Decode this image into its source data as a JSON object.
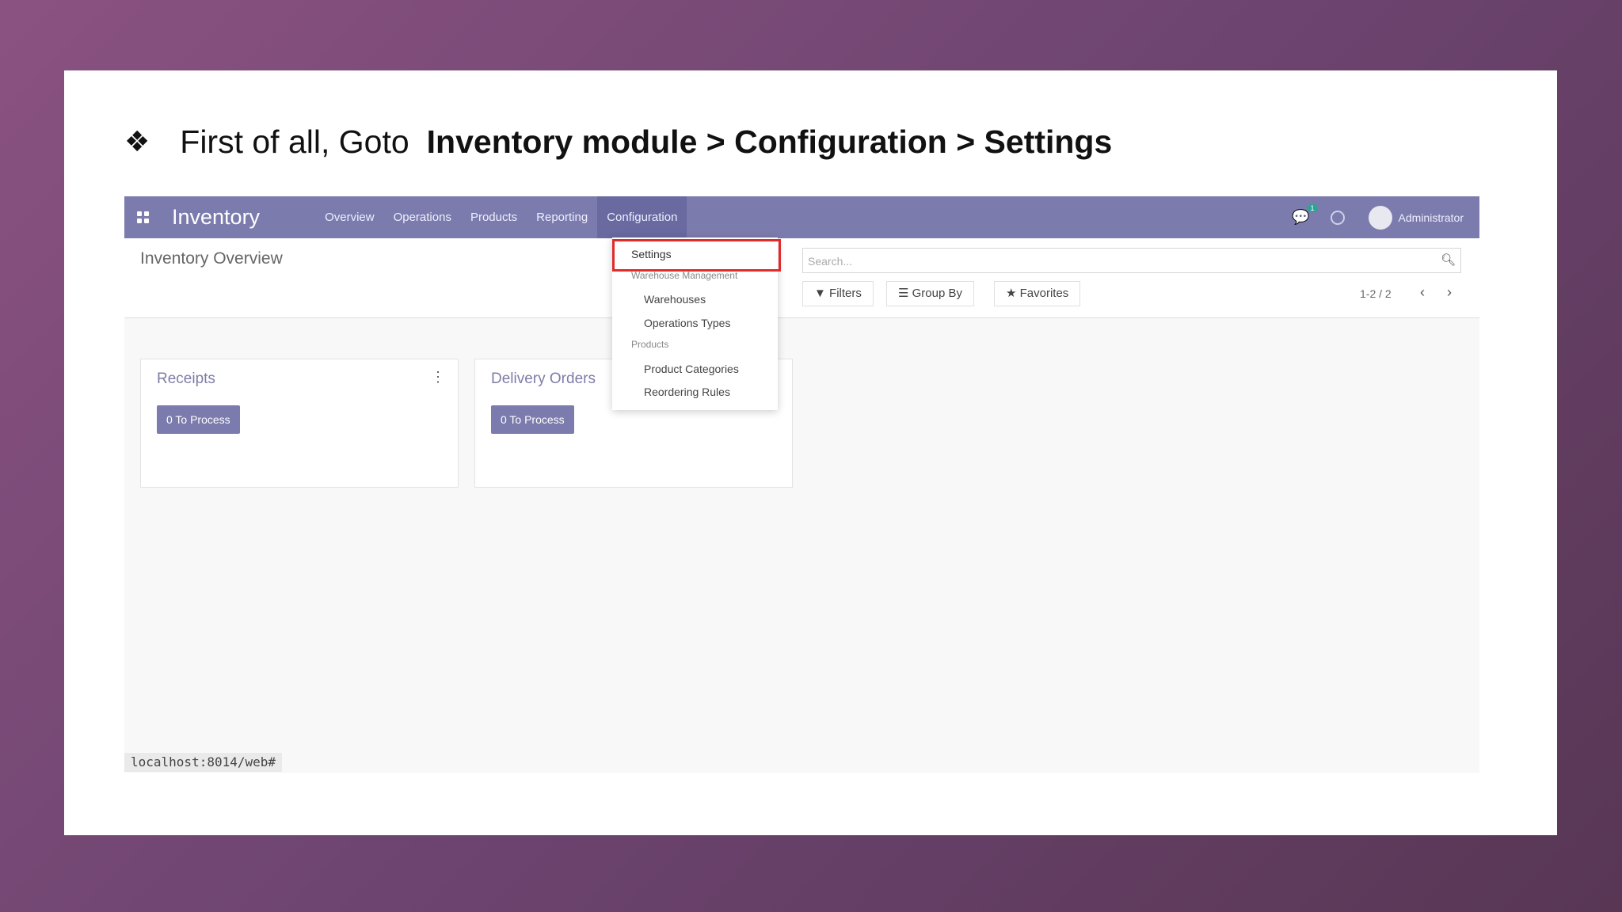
{
  "instruction": {
    "bullet": "❖",
    "text": "First of all, Goto",
    "path": "Inventory module > Configuration > Settings"
  },
  "navbar": {
    "brand": "Inventory",
    "items": [
      "Overview",
      "Operations",
      "Products",
      "Reporting",
      "Configuration"
    ],
    "chat_badge": "1",
    "user": "Administrator"
  },
  "control_panel": {
    "breadcrumb": "Inventory Overview",
    "search_placeholder": "Search...",
    "filters": "Filters",
    "group_by": "Group By",
    "favorites": "Favorites",
    "pager": "1-2 / 2"
  },
  "cards": [
    {
      "title": "Receipts",
      "button": "0 To Process"
    },
    {
      "title": "Delivery Orders",
      "button": "0 To Process"
    }
  ],
  "dropdown": {
    "settings": "Settings",
    "warehouse_header": "Warehouse Management",
    "warehouses": "Warehouses",
    "operation_types": "Operations Types",
    "products_header": "Products",
    "product_categories": "Product Categories",
    "reordering_rules": "Reordering Rules"
  },
  "statusbar": "localhost:8014/web#",
  "colors": {
    "navbar": "#7c7bad",
    "highlight": "#e02b2b",
    "background": "#6d4470"
  }
}
